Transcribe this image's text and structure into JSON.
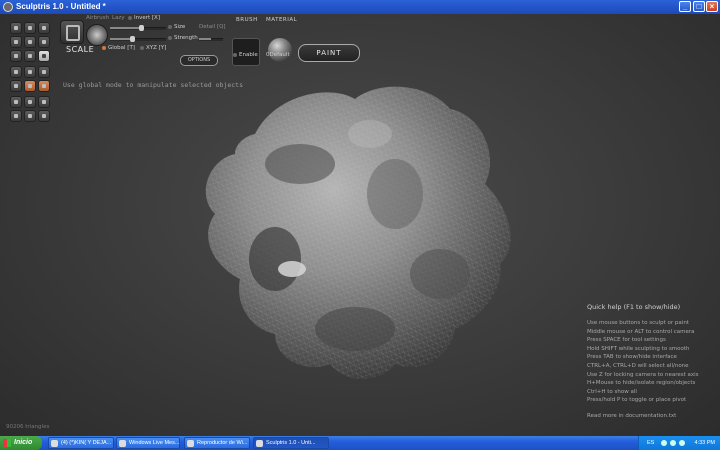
{
  "window": {
    "title": "Sculptris 1.0 - Untitled *"
  },
  "toolbar": {
    "tool_label": "SCALE",
    "airbrush_label": "Airbrush",
    "lazy_label": "Lazy",
    "invert_label": "Invert [X]",
    "size_label": "Size",
    "detail_label": "Detail [Q]",
    "strength_label": "Strength",
    "global_label": "Global [T]",
    "xyz_label": "XYZ [Y]",
    "options_label": "OPTIONS",
    "size_value": 0.55,
    "strength_value": 0.4
  },
  "brush": {
    "title": "BRUSH",
    "enable_label": "Enable"
  },
  "material": {
    "title": "MATERIAL",
    "name": "0Default"
  },
  "paint_button": "PAINT",
  "hint": "Use global mode to manipulate selected objects",
  "triangles": "90206 triangles",
  "quick_help": {
    "title": "Quick help (F1 to show/hide)",
    "lines": [
      "Use mouse buttons to sculpt or paint",
      "Middle mouse or ALT to control camera",
      "Press SPACE for tool settings",
      "Hold SHIFT while sculpting to smooth",
      "Press TAB to show/hide interface",
      "CTRL+A, CTRL+D will select all/none",
      "Use Z for locking camera to nearest axis",
      "H+Mouse to hide/isolate region/objects",
      "Ctrl+H to show all",
      "Press/hold P to toggle or place pivot"
    ],
    "footer": "Read more in documentation.txt"
  },
  "taskbar": {
    "start": "Inicio",
    "tasks": [
      "(4) (*)KIN( Y DEJA...",
      "Windows Live Mes...",
      "Reproductor de Wi...",
      "Sculptris 1.0 - Unti..."
    ],
    "lang": "ES",
    "clock": "4:33 PM"
  },
  "colors": {
    "accent_orange": "#d17a3d",
    "viewport_bg": "#3d3d3d",
    "taskbar_blue": "#245edb"
  }
}
